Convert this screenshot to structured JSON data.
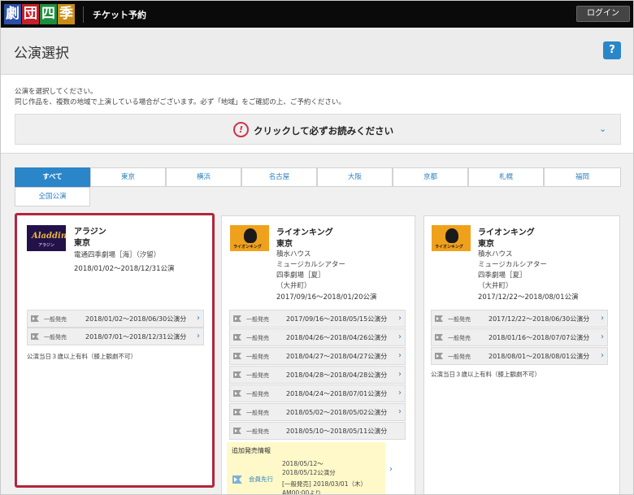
{
  "header": {
    "logo_chars": [
      "劇",
      "団",
      "四",
      "季"
    ],
    "site_title": "チケット予約",
    "login_label": "ログイン"
  },
  "page": {
    "title": "公演選択",
    "help_label": "?",
    "intro_line1": "公演を選択してください。",
    "intro_line2": "同じ作品を、複数の地域で上演している場合がございます。必ず「地域」をご確認の上、ご予約ください。",
    "notice_icon": "!",
    "notice_text": "クリックして必ずお読みください",
    "notice_chevron": "⌄"
  },
  "tabs": [
    "すべて",
    "東京",
    "横浜",
    "名古屋",
    "大阪",
    "京都",
    "札幌",
    "福岡",
    "全国公演"
  ],
  "cards": [
    {
      "thumb_text": "Aladdin",
      "thumb_sub": "アラジン",
      "title": "アラジン",
      "region": "東京",
      "venue_lines": [
        "電通四季劇場［海］（汐留）"
      ],
      "period": "2018/01/02〜2018/12/31公演",
      "sales": [
        {
          "label": "一般発売",
          "dates": "2018/01/02〜2018/06/30公演分"
        },
        {
          "label": "一般発売",
          "dates": "2018/07/01〜2018/12/31公演分"
        }
      ],
      "note": "公演当日３歳以上有料（膝上観劇不可）"
    },
    {
      "thumb_text": "ライオンキング",
      "title": "ライオンキング",
      "region": "東京",
      "venue_lines": [
        "積水ハウス",
        "ミュージカルシアター",
        "四季劇場［夏］",
        "（大井町）"
      ],
      "period": "2017/09/16〜2018/01/20公演",
      "sales": [
        {
          "label": "一般発売",
          "dates": "2017/09/16〜2018/05/15公演分"
        },
        {
          "label": "一般発売",
          "dates": "2018/04/26〜2018/04/26公演分"
        },
        {
          "label": "一般発売",
          "dates": "2018/04/27〜2018/04/27公演分"
        },
        {
          "label": "一般発売",
          "dates": "2018/04/28〜2018/04/28公演分"
        },
        {
          "label": "一般発売",
          "dates": "2018/04/24〜2018/07/01公演分"
        },
        {
          "label": "一般発売",
          "dates": "2018/05/02〜2018/05/02公演分"
        },
        {
          "label": "一般発売",
          "dates": "2018/05/10〜2018/05/11公演分"
        }
      ],
      "extra": {
        "title": "追加発売情報",
        "dates_a1": "2018/05/12〜",
        "dates_a2": "2018/05/12公演分",
        "label": "会員先行",
        "dates_b1": "[一般発売] 2018/03/01（木）",
        "dates_b2": "AM00:00より"
      }
    },
    {
      "thumb_text": "ライオンキング",
      "title": "ライオンキング",
      "region": "東京",
      "venue_lines": [
        "積水ハウス",
        "ミュージカルシアター",
        "四季劇場［夏］",
        "（大井町）"
      ],
      "period": "2017/12/22〜2018/08/01公演",
      "sales": [
        {
          "label": "一般発売",
          "dates": "2017/12/22〜2018/06/30公演分"
        },
        {
          "label": "一般発売",
          "dates": "2018/01/16〜2018/07/07公演分"
        },
        {
          "label": "一般発売",
          "dates": "2018/08/01〜2018/08/01公演分"
        }
      ],
      "note": "公演当日３歳以上有料（膝上観劇不可）"
    }
  ],
  "colors": {
    "accent_blue": "#2a86c8",
    "selected_border": "#b3263a",
    "notice_icon": "#d0324a",
    "extra_bg": "#fff9c9"
  }
}
